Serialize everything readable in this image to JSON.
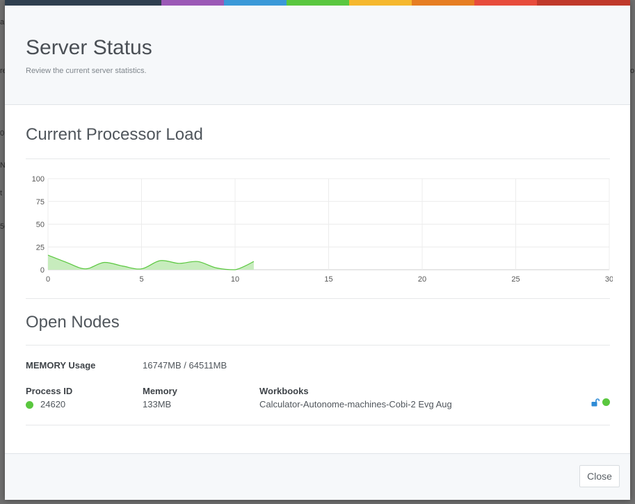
{
  "modal": {
    "title": "Server Status",
    "subtitle": "Review the current server statistics.",
    "rainbow_colors": [
      "#2f3f4f",
      "#9b59b6",
      "#3a99d8",
      "#5ac73f",
      "#f5b82e",
      "#e67e22",
      "#e74c3c",
      "#c0392b"
    ]
  },
  "processor": {
    "title": "Current Processor Load"
  },
  "chart_data": {
    "type": "area",
    "title": "",
    "xlabel": "",
    "ylabel": "",
    "xlim": [
      0,
      30
    ],
    "ylim": [
      0,
      100
    ],
    "x_ticks": [
      "0",
      "5",
      "10",
      "15",
      "20",
      "25",
      "30"
    ],
    "y_ticks": [
      "100",
      "75",
      "50",
      "25",
      "0"
    ],
    "grid": true,
    "color": "#5ac73f",
    "fill": "#c7ecbd",
    "series": [
      {
        "x": [
          0,
          1,
          2,
          3,
          4,
          5,
          6,
          7,
          8,
          9,
          10,
          11
        ],
        "y": [
          16,
          8,
          1,
          8,
          4,
          1,
          10,
          7,
          9,
          2,
          0,
          9
        ]
      }
    ]
  },
  "nodes": {
    "title": "Open Nodes",
    "memory_usage_label": "MEMORY Usage",
    "memory_usage_value": "16747MB / 64511MB",
    "columns": {
      "pid": "Process ID",
      "memory": "Memory",
      "workbooks": "Workbooks"
    },
    "rows": [
      {
        "pid": "24620",
        "memory": "133MB",
        "workbook": "Calculator-Autonome-machines-Cobi-2 Evg Aug",
        "status_color": "#5ac73f",
        "lock_icon": "unlock-icon"
      }
    ]
  },
  "footer": {
    "close_label": "Close"
  },
  "background": {
    "fragments": [
      "a",
      "re",
      "0",
      "N",
      "t",
      "50",
      "o"
    ]
  }
}
